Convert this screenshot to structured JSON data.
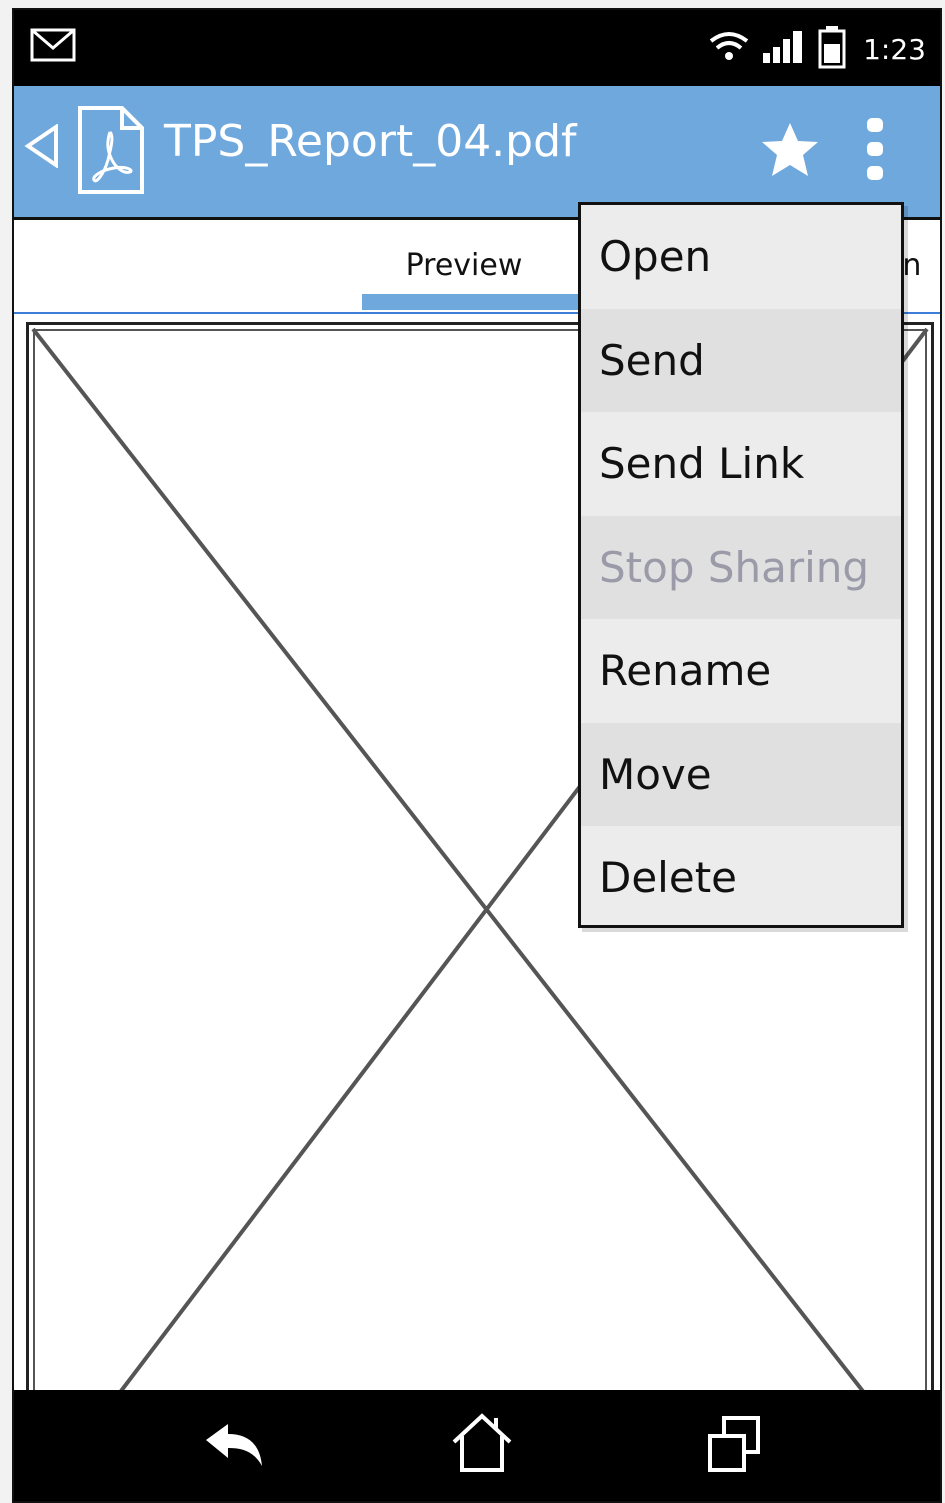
{
  "status_bar": {
    "time": "1:23",
    "icons": [
      "mail-icon",
      "wifi-icon",
      "signal-icon",
      "battery-icon"
    ]
  },
  "app_bar": {
    "title": "TPS_Report_04.pdf",
    "icons": [
      "back-icon",
      "pdf-icon",
      "star-icon",
      "overflow-menu-icon"
    ],
    "background": "#6fa8dc"
  },
  "tabs": {
    "active": "Preview",
    "partial_right": "on"
  },
  "menu": {
    "items": [
      {
        "label": "Open"
      },
      {
        "label": "Send"
      },
      {
        "label": "Send Link"
      },
      {
        "label": "Stop Sharing"
      },
      {
        "label": "Rename"
      },
      {
        "label": "Move"
      },
      {
        "label": "Delete"
      }
    ]
  },
  "nav_bar": {
    "icons": [
      "nav-back-icon",
      "nav-home-icon",
      "nav-recent-apps-icon"
    ]
  }
}
